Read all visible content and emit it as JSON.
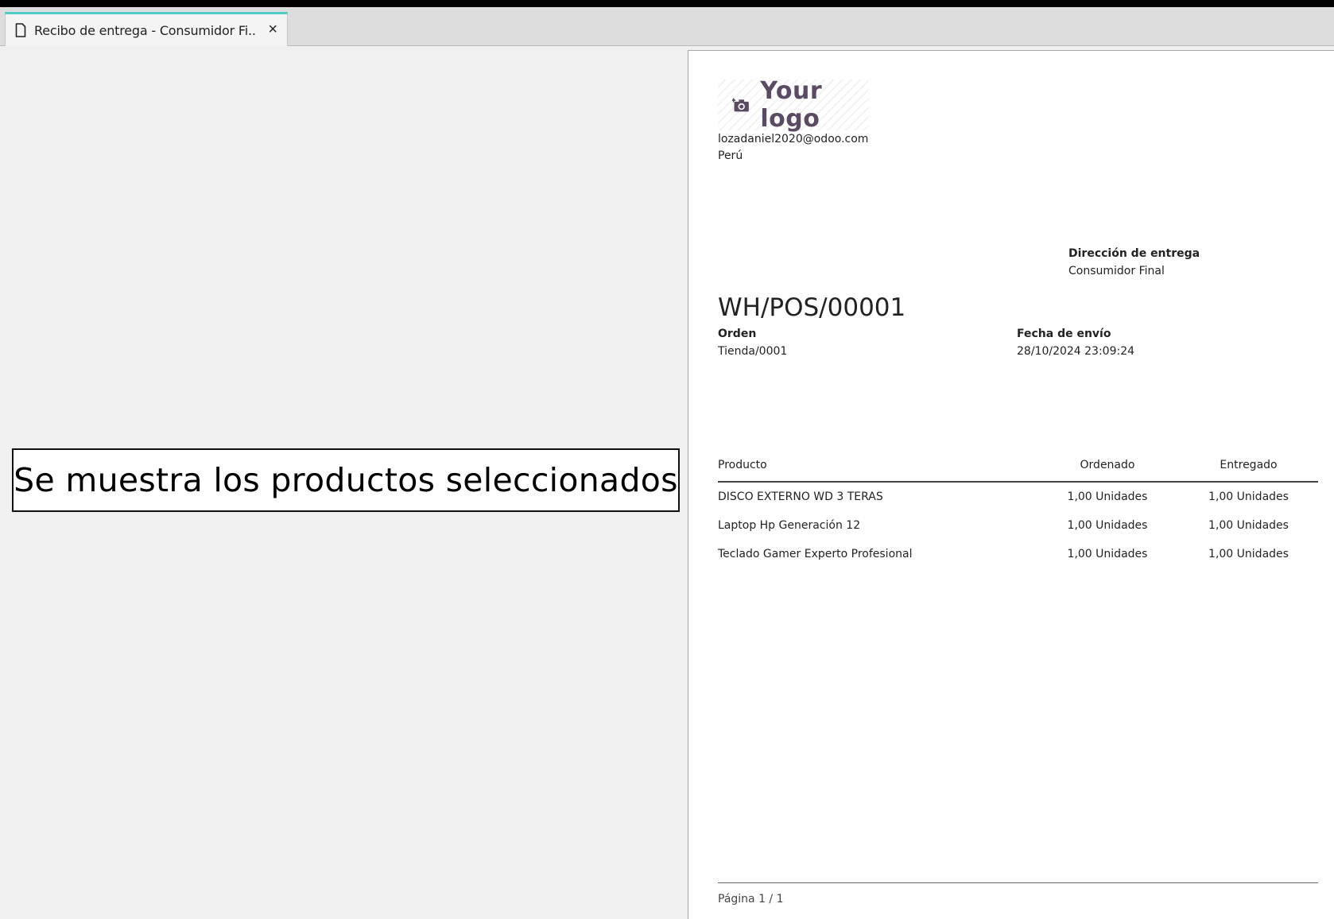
{
  "window": {
    "tab_title": "Recibo de entrega - Consumidor Fi...",
    "tab_close": "×"
  },
  "annotation": {
    "text": "Se muestra los productos seleccionados"
  },
  "document": {
    "logo_text": "Your logo",
    "company_email": "lozadaniel2020@odoo.com",
    "company_country": "Perú",
    "delivery_address_label": "Dirección de entrega",
    "delivery_address_value": "Consumidor Final",
    "title": "WH/POS/00001",
    "order_label": "Orden",
    "order_value": "Tienda/0001",
    "ship_date_label": "Fecha de envío",
    "ship_date_value": "28/10/2024 23:09:24",
    "table": {
      "headers": [
        "Producto",
        "Ordenado",
        "Entregado"
      ],
      "rows": [
        {
          "product": "DISCO EXTERNO WD 3 TERAS",
          "ordered": "1,00 Unidades",
          "delivered": "1,00 Unidades"
        },
        {
          "product": "Laptop Hp Generación 12",
          "ordered": "1,00 Unidades",
          "delivered": "1,00 Unidades"
        },
        {
          "product": "Teclado Gamer Experto Profesional",
          "ordered": "1,00 Unidades",
          "delivered": "1,00 Unidades"
        }
      ]
    },
    "footer_page": "Página 1 / 1"
  },
  "colors": {
    "tab_accent": "#4ecdc4",
    "logo_color": "#5b4a63"
  },
  "icons": {
    "tab_icon": "document-icon",
    "logo_icon": "camera-icon"
  }
}
